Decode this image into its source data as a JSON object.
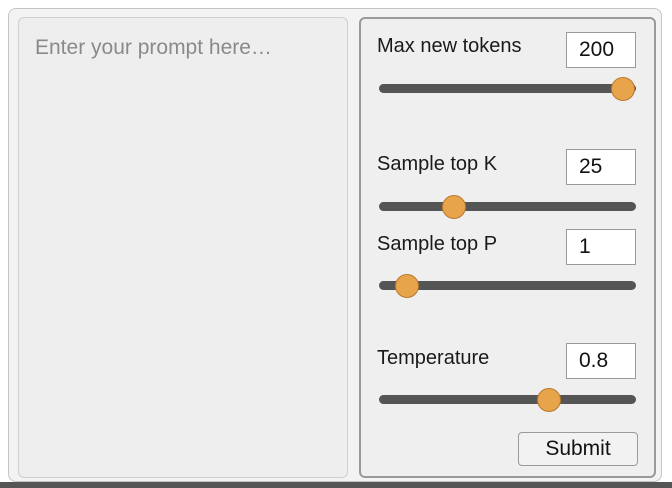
{
  "prompt": {
    "placeholder": "Enter your prompt here…",
    "value": ""
  },
  "controls": {
    "max_new_tokens": {
      "label": "Max new tokens",
      "value": "200",
      "slider_fraction": 0.95
    },
    "top_k": {
      "label": "Sample top K",
      "value": "25",
      "slider_fraction": 0.29
    },
    "top_p": {
      "label": "Sample top P",
      "value": "1",
      "slider_fraction": 0.11
    },
    "temperature": {
      "label": "Temperature",
      "value": "0.8",
      "slider_fraction": 0.66
    }
  },
  "submit_label": "Submit",
  "colors": {
    "thumb": "#e8a44a",
    "track": "#555555",
    "panel": "#efefef"
  }
}
